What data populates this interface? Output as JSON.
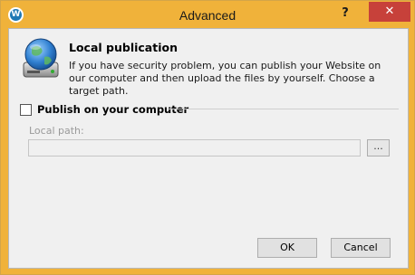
{
  "window": {
    "title": "Advanced",
    "help_label": "?",
    "close_label": "✕",
    "app_icon_letter": "W"
  },
  "header": {
    "icon": "hard-drive-globe-icon",
    "title": "Local publication",
    "description": "If you have security problem, you can publish your Website on our computer and then upload the files by yourself. Choose a target path."
  },
  "publish": {
    "checkbox_label": "Publish on your computer",
    "checked": false,
    "path_label": "Local path:",
    "path_value": "",
    "browse_label": "..."
  },
  "buttons": {
    "ok": "OK",
    "cancel": "Cancel"
  },
  "colors": {
    "titlebar": "#f0b23a",
    "close": "#c7413a",
    "dialog_bg": "#f0f0f0"
  }
}
